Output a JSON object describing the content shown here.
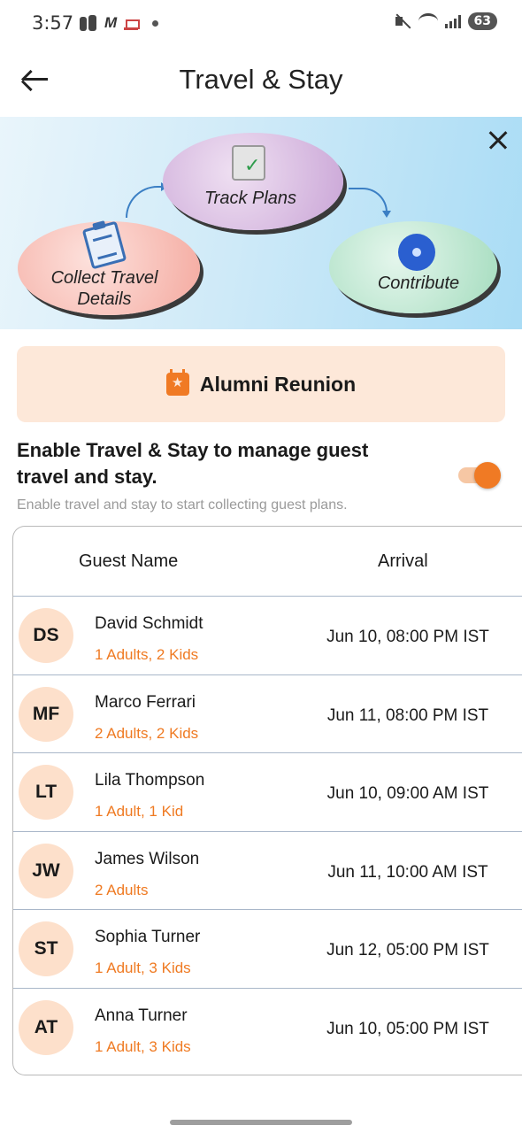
{
  "status_bar": {
    "time": "3:57",
    "battery": "63"
  },
  "header": {
    "title": "Travel & Stay"
  },
  "banner": {
    "step1": "Collect Travel Details",
    "step2": "Track Plans",
    "step3": "Contribute"
  },
  "event": {
    "name": "Alumni Reunion"
  },
  "toggle": {
    "title": "Enable Travel & Stay to manage guest travel and stay.",
    "subtitle": "Enable travel and stay to start collecting guest plans.",
    "enabled": true
  },
  "table": {
    "columns": {
      "name": "Guest Name",
      "arrival": "Arrival"
    },
    "rows": [
      {
        "initials": "DS",
        "name": "David Schmidt",
        "party": "1 Adults, 2 Kids",
        "arrival": "Jun 10, 08:00 PM IST"
      },
      {
        "initials": "MF",
        "name": "Marco Ferrari",
        "party": "2 Adults, 2 Kids",
        "arrival": "Jun 11, 08:00 PM IST"
      },
      {
        "initials": "LT",
        "name": "Lila Thompson",
        "party": "1 Adult, 1 Kid",
        "arrival": "Jun 10, 09:00 AM IST"
      },
      {
        "initials": "JW",
        "name": "James Wilson",
        "party": "2 Adults",
        "arrival": "Jun 11, 10:00 AM IST"
      },
      {
        "initials": "ST",
        "name": "Sophia Turner",
        "party": "1 Adult, 3 Kids",
        "arrival": "Jun 12, 05:00 PM IST"
      },
      {
        "initials": "AT",
        "name": "Anna Turner",
        "party": "1 Adult, 3 Kids",
        "arrival": "Jun 10, 05:00 PM IST"
      }
    ]
  },
  "colors": {
    "accent": "#f07a24",
    "event_bg": "#fde8d9",
    "avatar_bg": "#fde0cb"
  }
}
